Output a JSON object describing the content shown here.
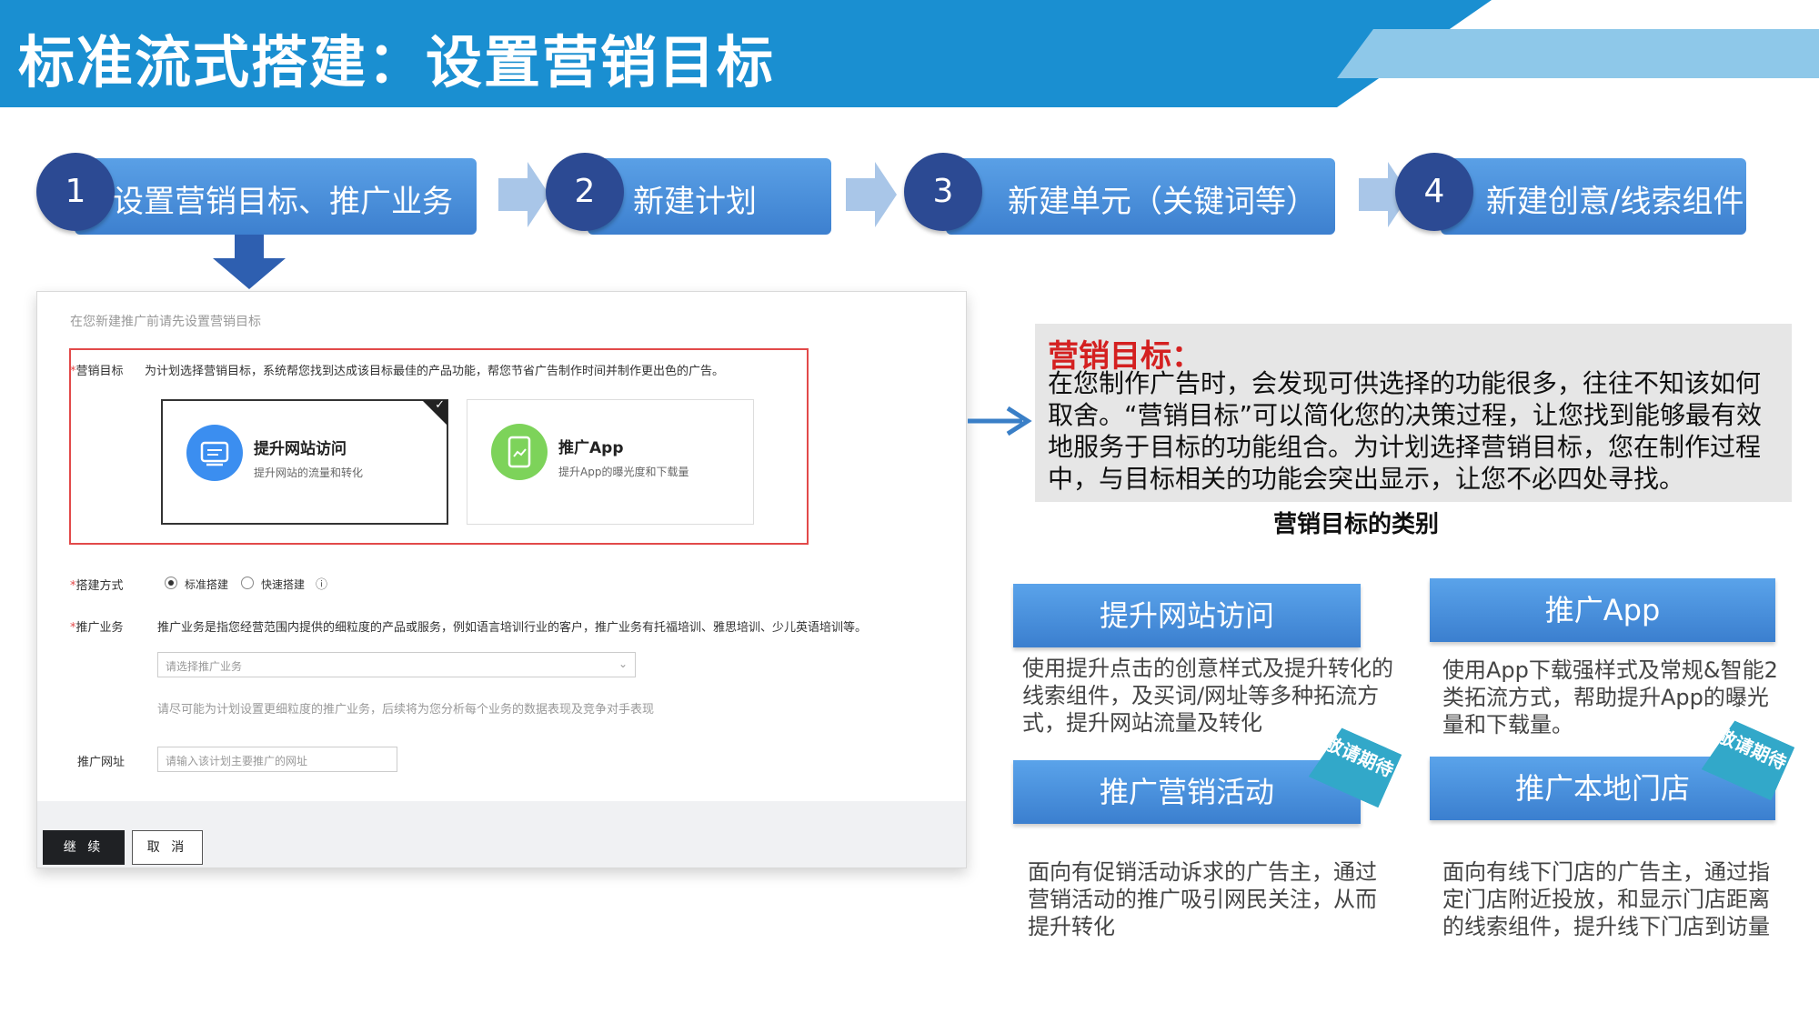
{
  "header": {
    "title": "标准流式搭建：设置营销目标"
  },
  "steps": [
    {
      "num": "1",
      "label": "设置营销目标、推广业务"
    },
    {
      "num": "2",
      "label": "新建计划"
    },
    {
      "num": "3",
      "label": "新建单元（关键词等）"
    },
    {
      "num": "4",
      "label": "新建创意/线索组件"
    }
  ],
  "form": {
    "hint": "在您新建推广前请先设置营销目标",
    "goal_label": "营销目标",
    "goal_desc": "为计划选择营销目标，系统帮您找到达成该目标最佳的产品功能，帮您节省广告制作时间并制作更出色的广告。",
    "options": [
      {
        "title": "提升网站访问",
        "subtitle": "提升网站的流量和转化",
        "icon": "screen-icon",
        "color": "#3b8ef0"
      },
      {
        "title": "推广App",
        "subtitle": "提升App的曝光度和下载量",
        "icon": "phone-icon",
        "color": "#7dd35a"
      }
    ],
    "build_label": "搭建方式",
    "build_options": [
      "标准搭建",
      "快速搭建"
    ],
    "biz_label": "推广业务",
    "biz_desc": "推广业务是指您经营范围内提供的细粒度的产品或服务，例如语言培训行业的客户，推广业务有托福培训、雅思培训、少儿英语培训等。",
    "biz_placeholder": "请选择推广业务",
    "biz_tip": "请尽可能为计划设置更细粒度的推广业务，后续将为您分析每个业务的数据表现及竞争对手表现",
    "url_label": "推广网址",
    "url_placeholder": "请输入该计划主要推广的网址",
    "continue_label": "继 续",
    "cancel_label": "取 消"
  },
  "explain": {
    "title": "营销目标：",
    "body": "在您制作广告时，会发现可供选择的功能很多，往往不知该如何取舍。“营销目标”可以简化您的决策过程，让您找到能够最有效地服务于目标的功能组合。为计划选择营销目标，您在制作过程中，与目标相关的功能会突出显示，让您不必四处寻找。"
  },
  "categories": {
    "title": "营销目标的类别",
    "items": [
      {
        "label": "提升网站访问",
        "desc": "使用提升点击的创意样式及提升转化的线索组件，及买词/网址等多种拓流方式，提升网站流量及转化"
      },
      {
        "label": "推广App",
        "desc": "使用App下载强样式及常规&智能2类拓流方式，帮助提升App的曝光量和下载量。"
      },
      {
        "label": "推广营销活动",
        "desc": "面向有促销活动诉求的广告主，通过营销活动的推广吸引网民关注，从而提升转化",
        "tag": "敬请期待"
      },
      {
        "label": "推广本地门店",
        "desc": "面向有线下门店的广告主，通过指定门店附近投放，和显示门店距离的线索组件，提升线下门店到访量",
        "tag": "敬请期待"
      }
    ]
  },
  "colors": {
    "header": "#1a8fd1",
    "step": "#4a8fdc",
    "circle": "#2c4a93",
    "required": "#e24a4a",
    "explain_title": "#d42020"
  }
}
